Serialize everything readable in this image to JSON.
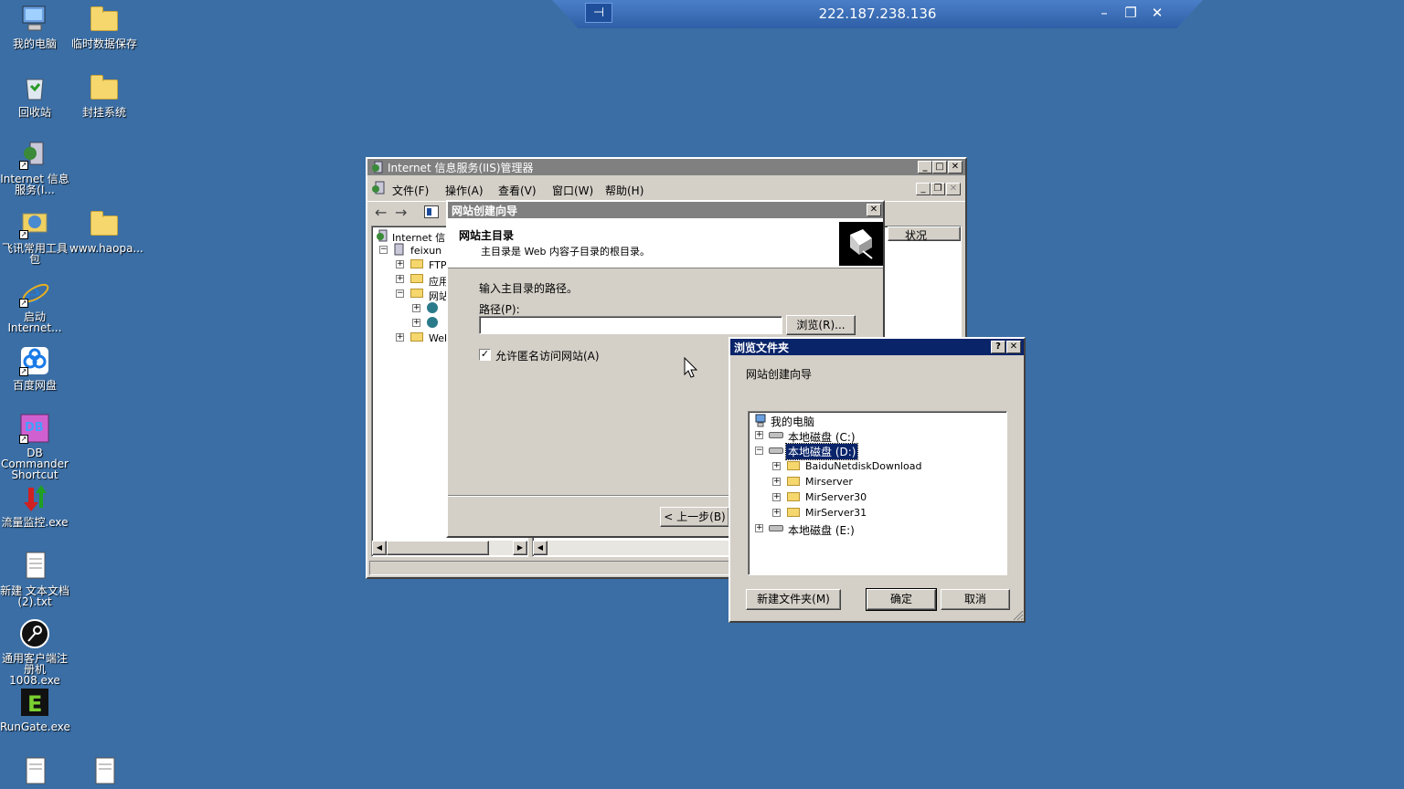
{
  "desktop": {
    "icons": [
      {
        "label": "我的电脑",
        "icon": "computer-icon"
      },
      {
        "label": "临时数据保存",
        "icon": "folder-icon"
      },
      {
        "label": "回收站",
        "icon": "recycle-bin-icon"
      },
      {
        "label": "封挂系统",
        "icon": "folder-icon"
      },
      {
        "label": "Internet 信息服务(I...",
        "icon": "iis-icon"
      },
      {
        "label": "飞讯常用工具包",
        "icon": "tools-icon"
      },
      {
        "label": "www.haopa...",
        "icon": "folder-icon"
      },
      {
        "label": "启动 Internet...",
        "icon": "internet-explorer-icon"
      },
      {
        "label": "百度网盘",
        "icon": "baidu-netdisk-icon"
      },
      {
        "label": "DB Commander Shortcut",
        "icon": "db-commander-icon"
      },
      {
        "label": "流量监控.exe",
        "icon": "traffic-monitor-icon"
      },
      {
        "label": "新建 文本文档 (2).txt",
        "icon": "text-file-icon"
      },
      {
        "label": "通用客户端注册机1008.exe",
        "icon": "keygen-icon"
      },
      {
        "label": "RunGate.exe",
        "icon": "rungate-icon"
      }
    ]
  },
  "rdp_bar": {
    "ip": "222.187.238.136",
    "pin": "⊣",
    "minimize": "–",
    "restore": "❐",
    "close": "✕"
  },
  "iis": {
    "title": "Internet 信息服务(IIS)管理器",
    "menu": [
      "文件(F)",
      "操作(A)",
      "查看(V)",
      "窗口(W)",
      "帮助(H)"
    ],
    "tree_root": "Internet 信",
    "tree_server": "feixun",
    "tree_items": [
      "FTP",
      "应用",
      "网站",
      "Web"
    ],
    "column_header": "状况"
  },
  "wizard": {
    "title": "网站创建向导",
    "heading": "网站主目录",
    "subheading": "主目录是 Web 内容子目录的根目录。",
    "prompt": "输入主目录的路径。",
    "path_label": "路径(P):",
    "path_value": "",
    "browse_label": "浏览(R)...",
    "anon_label": "允许匿名访问网站(A)",
    "anon_checked": true,
    "back_label": "< 上一步(B)"
  },
  "browse": {
    "title": "浏览文件夹",
    "description": "网站创建向导",
    "tree": {
      "root": "我的电脑",
      "drive_c": "本地磁盘 (C:)",
      "drive_d": "本地磁盘 (D:)",
      "d_folders": [
        "BaiduNetdiskDownload",
        "Mirserver",
        "MirServer30",
        "MirServer31"
      ],
      "drive_e": "本地磁盘 (E:)"
    },
    "new_folder_label": "新建文件夹(M)",
    "ok_label": "确定",
    "cancel_label": "取消"
  }
}
